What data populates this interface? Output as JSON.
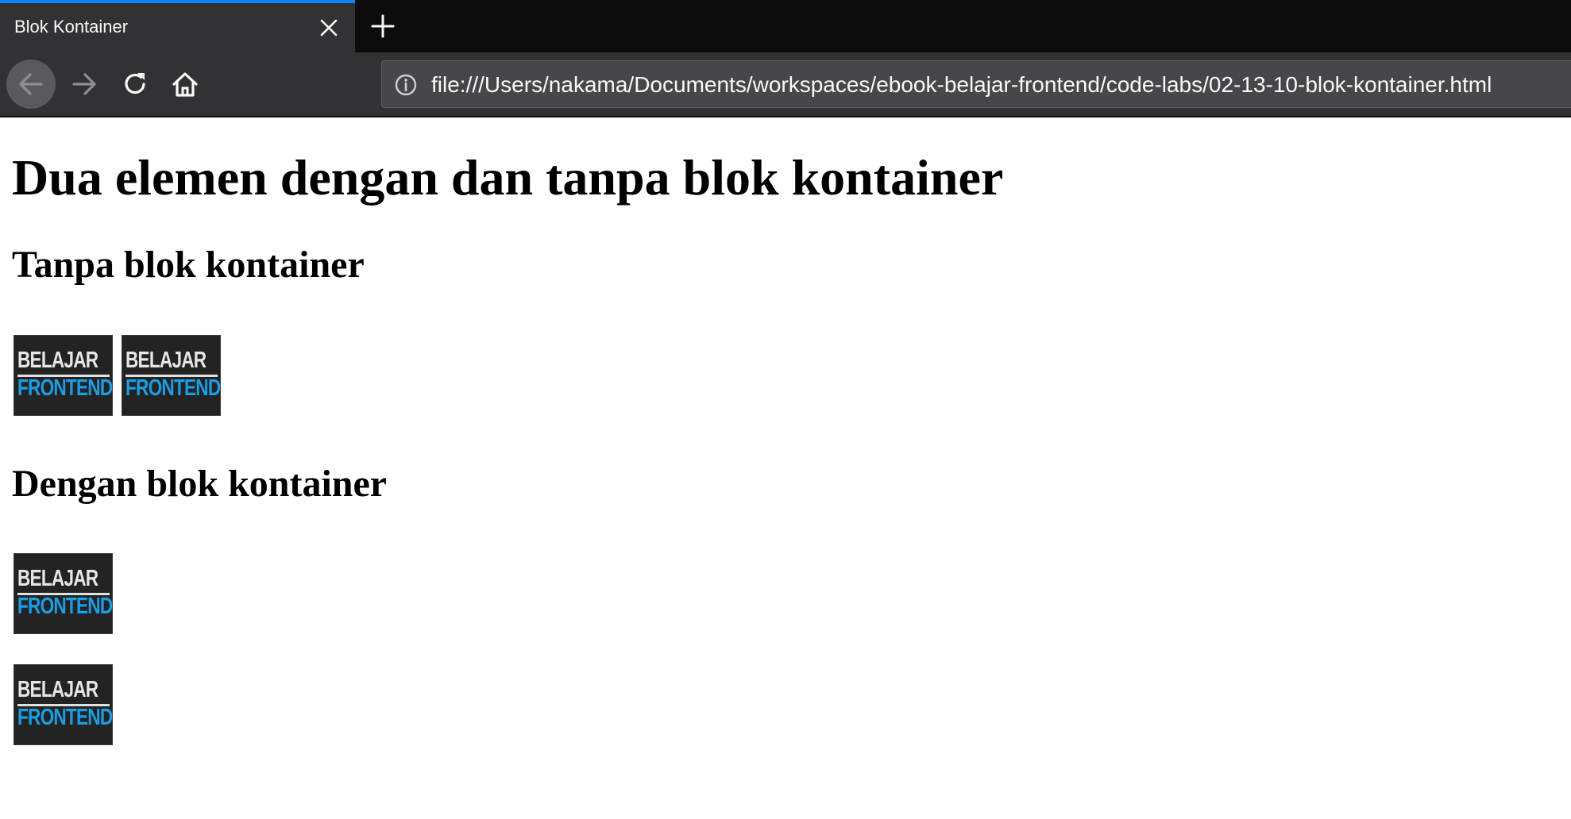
{
  "browser": {
    "tab": {
      "title": "Blok Kontainer",
      "close_icon": "close-icon"
    },
    "new_tab_icon": "plus-icon",
    "nav": {
      "back_icon": "arrow-left-icon",
      "forward_icon": "arrow-right-icon",
      "reload_icon": "reload-icon",
      "home_icon": "home-icon"
    },
    "url": {
      "info_icon": "info-icon",
      "text": "file:///Users/nakama/Documents/workspaces/ebook-belajar-frontend/code-labs/02-13-10-blok-kontainer.html"
    },
    "colors": {
      "tab_accent": "#0a84ff",
      "chrome_dark": "#0c0c0d",
      "chrome": "#323234"
    }
  },
  "page": {
    "title": "Dua elemen dengan dan tanpa blok kontainer",
    "sections": [
      {
        "heading": "Tanpa blok kontainer",
        "images": [
          {
            "top": "BELAJAR",
            "bottom": "FRONTEND"
          },
          {
            "top": "BELAJAR",
            "bottom": "FRONTEND"
          }
        ]
      },
      {
        "heading": "Dengan blok kontainer",
        "images": [
          {
            "top": "BELAJAR",
            "bottom": "FRONTEND"
          },
          {
            "top": "BELAJAR",
            "bottom": "FRONTEND"
          }
        ]
      }
    ],
    "logo_colors": {
      "background": "#232323",
      "top_text": "#e6e6e6",
      "bottom_text": "#1a9ee6"
    }
  }
}
